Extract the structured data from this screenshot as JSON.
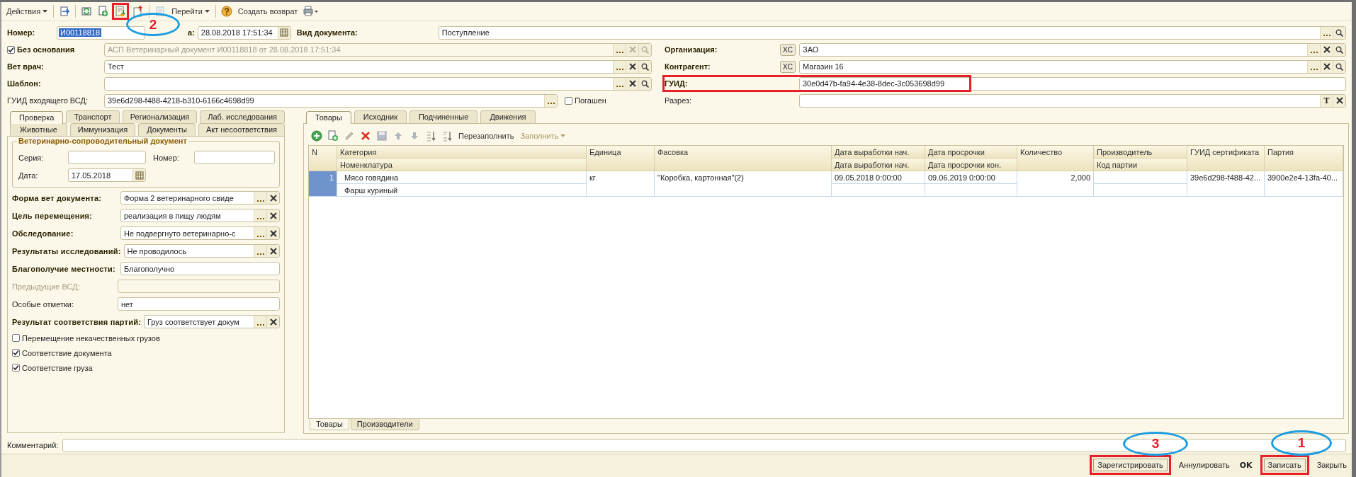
{
  "toolbar": {
    "actions_menu": "Действия",
    "icons": [
      {
        "kind": "post",
        "highlighted": false
      },
      {
        "kind": "refresh",
        "highlighted": false
      },
      {
        "kind": "add_copy",
        "highlighted": false
      },
      {
        "kind": "load",
        "highlighted": true
      },
      {
        "kind": "unload",
        "highlighted": false
      },
      {
        "kind": "doc",
        "highlighted": false
      }
    ],
    "goto_menu": "Перейти",
    "create_return": "Создать возврат"
  },
  "header": {
    "number": {
      "label": "Номер:",
      "value": "И00118818",
      "text_selected": true
    },
    "date": {
      "label": "а:",
      "value": "28.08.2018 17:51:34"
    },
    "doc_type": {
      "label": "Вид документа:",
      "value": "Поступление"
    }
  },
  "left_fields": [
    {
      "kind": "checkbox_field",
      "label": "Без основания",
      "checked": true,
      "bold": true,
      "value": "АСП Ветеринарный документ И00118818 от 28.08.2018 17:51:34",
      "disabled": true,
      "buttons": [
        {
          "kind": "select"
        },
        {
          "kind": "clear"
        },
        {
          "kind": "search"
        }
      ]
    },
    {
      "kind": "field",
      "label": "Вет врач:",
      "bold": true,
      "value": "Тест",
      "disabled": false,
      "buttons": [
        {
          "kind": "select"
        },
        {
          "kind": "clear"
        },
        {
          "kind": "search"
        }
      ]
    },
    {
      "kind": "field",
      "label": "Шаблон:",
      "bold": true,
      "disabled": false,
      "buttons": [
        {
          "kind": "select"
        },
        {
          "kind": "clear"
        },
        {
          "kind": "search"
        }
      ]
    },
    {
      "kind": "field",
      "label": "ГУИД входящего ВСД:",
      "bold": false,
      "value": "39e6d298-f488-4218-b310-6166c4698d99",
      "disabled": false,
      "buttons": [
        {
          "kind": "select"
        }
      ]
    }
  ],
  "paid": {
    "label": "Погашен",
    "checked": false
  },
  "right_fields": [
    {
      "label": "Организация:",
      "bold": true,
      "type_button": "XC",
      "value": "ЗАО",
      "buttons": [
        {
          "kind": "select"
        },
        {
          "kind": "clear"
        },
        {
          "kind": "search"
        }
      ],
      "highlighted": false
    },
    {
      "label": "Контрагент:",
      "bold": true,
      "type_button": "XC",
      "value": "Магазин 16",
      "buttons": [
        {
          "kind": "select"
        },
        {
          "kind": "clear"
        },
        {
          "kind": "search"
        }
      ],
      "highlighted": false
    },
    {
      "label": "ГУИД:",
      "bold": true,
      "value": "30e0d47b-fa94-4e38-8dec-3c053698d99",
      "highlighted": true
    },
    {
      "label": "Разрез:",
      "bold": false,
      "text_button": "T",
      "buttons": [
        {
          "kind": "clear"
        }
      ],
      "highlighted": false
    }
  ],
  "left_tabs": [
    {
      "tabs": [
        {
          "label": "Проверка",
          "selected": true
        },
        {
          "label": "Транспорт",
          "selected": false
        },
        {
          "label": "Регионализация",
          "selected": false
        },
        {
          "label": "Лаб. исследования",
          "selected": false
        }
      ]
    },
    {
      "tabs": [
        {
          "label": "Животные",
          "selected": false
        },
        {
          "label": "Иммунизация",
          "selected": false
        },
        {
          "label": "Документы",
          "selected": false
        },
        {
          "label": "Акт несоответствия",
          "selected": false
        }
      ]
    }
  ],
  "vsd_group": {
    "title": "Ветеринарно-сопроводительный документ",
    "series_label": "Серия:",
    "number_label": "Номер:",
    "date_label": "Дата:",
    "date_value": "17.05.2018"
  },
  "check_fields": [
    {
      "label": "Форма вет документа:",
      "bold": true,
      "disabled": false,
      "value": "Форма 2 ветеринарного свиде",
      "buttons": [
        {
          "kind": "select"
        },
        {
          "kind": "clear"
        }
      ]
    },
    {
      "label": "Цель перемещения:",
      "bold": true,
      "disabled": false,
      "value": "реализация в пищу людям",
      "buttons": [
        {
          "kind": "select"
        },
        {
          "kind": "clear"
        }
      ]
    },
    {
      "label": "Обследование:",
      "bold": true,
      "disabled": false,
      "value": "Не подвергнуто ветеринарно-с",
      "buttons": [
        {
          "kind": "select"
        },
        {
          "kind": "clear"
        }
      ]
    },
    {
      "label": "Результаты исследований:",
      "bold": true,
      "disabled": false,
      "value": "Не проводилось",
      "buttons": [
        {
          "kind": "select"
        },
        {
          "kind": "clear"
        }
      ]
    },
    {
      "label": "Благополучие местности:",
      "bold": true,
      "disabled": false,
      "value": "Благополучно"
    },
    {
      "label": "Предыдущие ВСД:",
      "bold": false,
      "disabled": true
    },
    {
      "label": "Особые отметки:",
      "bold": false,
      "disabled": false,
      "value": "нет"
    },
    {
      "label": "Результат соответствия партий:",
      "bold": true,
      "disabled": false,
      "value": "Груз соответствует докум",
      "buttons": [
        {
          "kind": "select"
        },
        {
          "kind": "clear"
        }
      ]
    }
  ],
  "checkboxes": [
    {
      "label": "Перемещение некачественных грузов",
      "checked": false
    },
    {
      "label": "Соответствие документа",
      "checked": true
    },
    {
      "label": "Соответствие груза",
      "checked": true
    }
  ],
  "right_tabs": [
    {
      "label": "Товары",
      "selected": true
    },
    {
      "label": "Исходник",
      "selected": false
    },
    {
      "label": "Подчиненные",
      "selected": false
    },
    {
      "label": "Движения",
      "selected": false
    }
  ],
  "table_toolbar": {
    "refill": "Перезаполнить",
    "fill_menu": {
      "label": "Заполнить",
      "disabled": true
    }
  },
  "table": {
    "columns": [
      {
        "header": "N"
      },
      {
        "header": "Категория",
        "subheader": "Номенклатура"
      },
      {
        "header": "Единица"
      },
      {
        "header": "Фасовка"
      },
      {
        "header": "Дата выработки нач.",
        "subheader": "Дата выработки нач."
      },
      {
        "header": "Дата просрочки",
        "subheader": "Дата просрочки кон."
      },
      {
        "header": "Количество",
        "numeric": true
      },
      {
        "header": "Производитель",
        "subheader": "Код партии"
      },
      {
        "header": "ГУИД сертификата"
      },
      {
        "header": "Партия"
      }
    ],
    "rows": [
      {
        "selected": true,
        "cells": [
          {
            "value": "1"
          },
          {
            "top": "Мясо говядина",
            "bottom": "Фарш куриный"
          },
          {
            "value": "кг"
          },
          {
            "value": "\"Коробка, картонная\"(2)"
          },
          {
            "top": "09.05.2018 0:00:00"
          },
          {
            "top": "09.06.2019 0:00:00"
          },
          {
            "value": "2,000"
          },
          {},
          {
            "value": "39e6d298-f488-42..."
          },
          {
            "value": "3900e2e4-13fa-40..."
          }
        ]
      }
    ]
  },
  "bottom_tabs": [
    {
      "label": "Товары",
      "selected": true
    },
    {
      "label": "Производители",
      "selected": false
    }
  ],
  "comment": {
    "label": "Комментарий:"
  },
  "footer_buttons": [
    {
      "label": "Зарегистрировать",
      "kind": "framed",
      "highlighted": true
    },
    {
      "label": "Аннулировать",
      "kind": "flat",
      "highlighted": false
    },
    {
      "label": "OK",
      "kind": "bold",
      "highlighted": false
    },
    {
      "label": "Записать",
      "kind": "framed",
      "highlighted": true
    },
    {
      "label": "Закрыть",
      "kind": "flat",
      "highlighted": false
    }
  ],
  "annotations": [
    {
      "label": "2"
    },
    {
      "label": "3"
    },
    {
      "label": "1"
    }
  ]
}
